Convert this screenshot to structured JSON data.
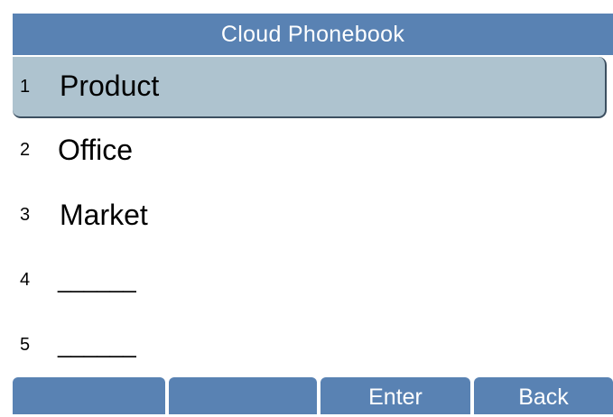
{
  "header": {
    "title": "Cloud Phonebook"
  },
  "list": {
    "items": [
      {
        "number": "1",
        "label": "Product",
        "selected": true
      },
      {
        "number": "2",
        "label": "Office",
        "selected": false
      },
      {
        "number": "3",
        "label": "Market",
        "selected": false
      },
      {
        "number": "4",
        "label": "______",
        "selected": false
      },
      {
        "number": "5",
        "label": "______",
        "selected": false
      }
    ]
  },
  "softkeys": {
    "key1": "",
    "key2": "",
    "key3": "Enter",
    "key4": "Back"
  },
  "colors": {
    "titlebar": "#5982b3",
    "selection": "#aec3cf",
    "softkey": "#5982b3",
    "text": "#000000",
    "text_on_blue": "#ffffff"
  }
}
